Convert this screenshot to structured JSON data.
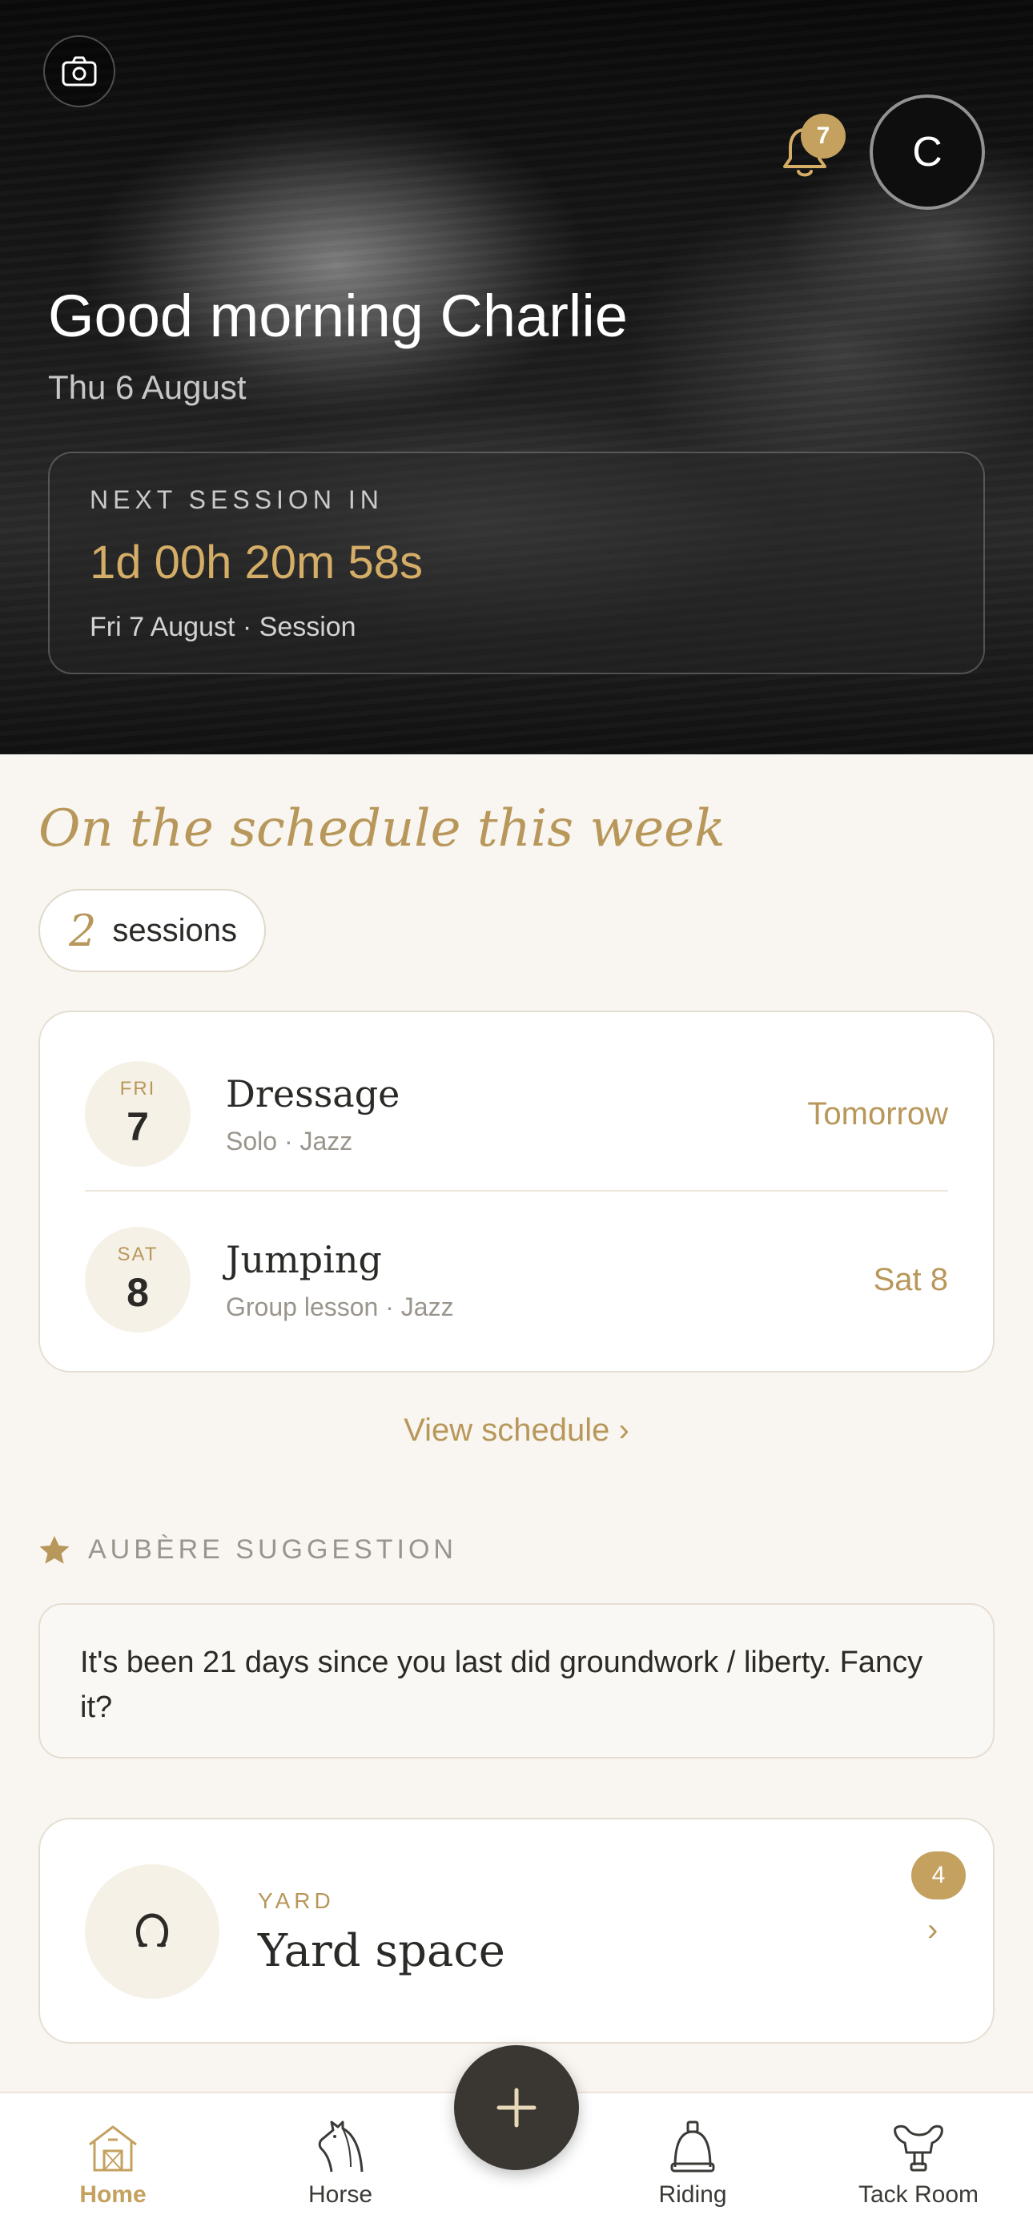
{
  "header": {
    "greeting": "Good morning Charlie",
    "date": "Thu 6 August",
    "notifications_count": "7",
    "avatar_initial": "C"
  },
  "next_session": {
    "label": "NEXT SESSION IN",
    "countdown": "1d 00h 20m 58s",
    "meta": "Fri 7 August · Session"
  },
  "schedule": {
    "title": "On the schedule this week",
    "count": "2",
    "count_label": "sessions",
    "items": [
      {
        "dow": "FRI",
        "day": "7",
        "title": "Dressage",
        "sub": "Solo · Jazz",
        "when": "Tomorrow"
      },
      {
        "dow": "SAT",
        "day": "8",
        "title": "Jumping",
        "sub": "Group lesson · Jazz",
        "when": "Sat 8"
      }
    ],
    "view_link": "View schedule ›"
  },
  "suggestion": {
    "label": "AUBÈRE SUGGESTION",
    "text": "It's been 21 days since you last did groundwork / liberty. Fancy it?"
  },
  "yard": {
    "eyebrow": "YARD",
    "title": "Yard space",
    "badge": "4",
    "chevron": "›"
  },
  "tabbar": {
    "tabs": [
      {
        "label": "Home",
        "icon": "barn-icon",
        "active": true
      },
      {
        "label": "Horse",
        "icon": "horse-head-icon"
      },
      {
        "label": "Riding",
        "icon": "stirrup-icon"
      },
      {
        "label": "Tack Room",
        "icon": "saddle-icon"
      }
    ],
    "fab_icon": "plus-icon"
  },
  "colors": {
    "accent": "#c4a15f",
    "background": "#f9f6f1",
    "fab": "#3a3631"
  }
}
